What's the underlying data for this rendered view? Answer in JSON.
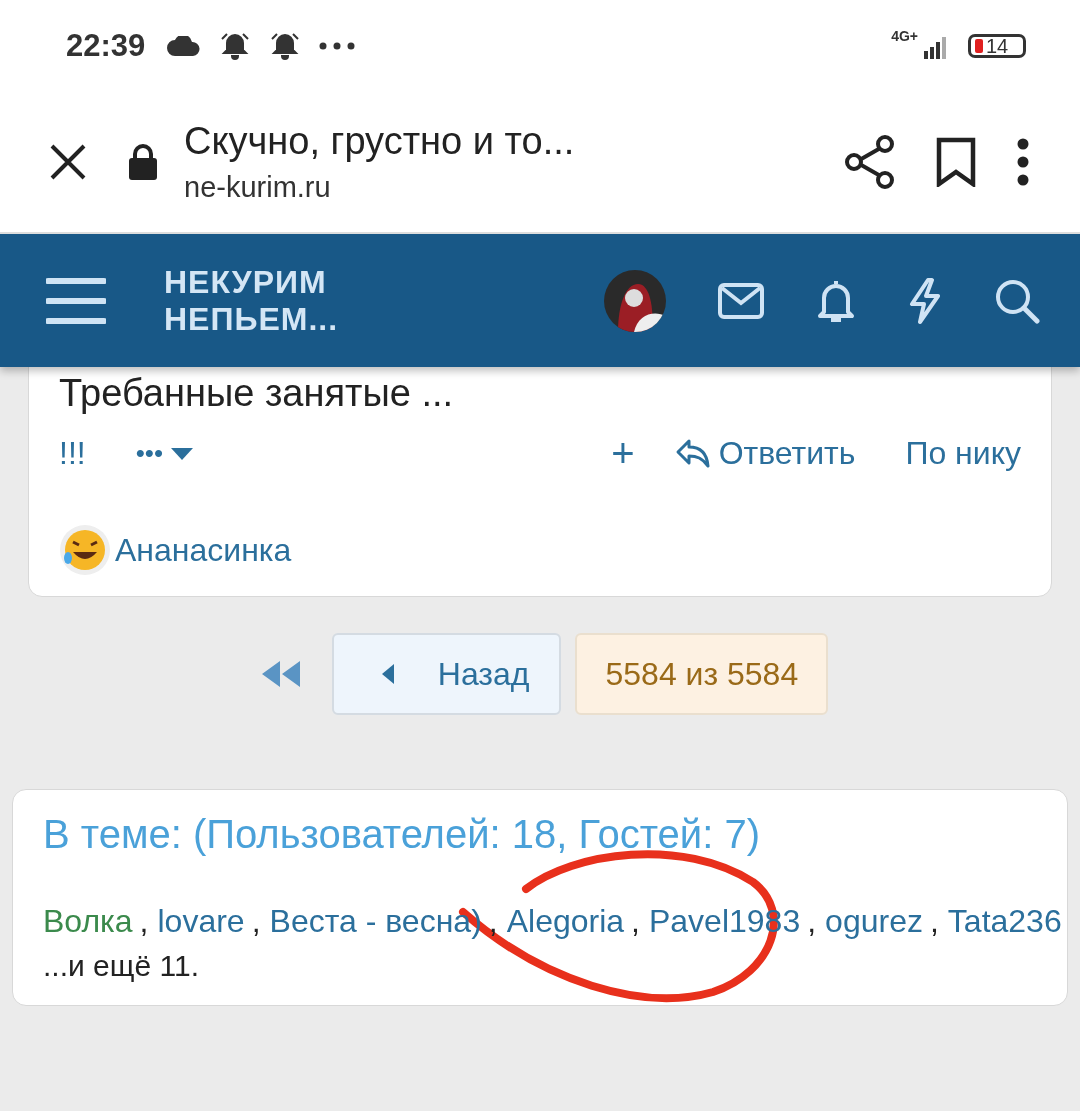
{
  "status_bar": {
    "time": "22:39",
    "network": "4G+",
    "battery": "14"
  },
  "browser": {
    "title": "Скучно, грустно и то...",
    "url": "ne-kurim.ru"
  },
  "site_header": {
    "logo_line_1": "НЕКУРИМ",
    "logo_line_2": "НЕПЬЕМ..."
  },
  "post": {
    "text_cut": "Требанные занятые ...",
    "actions_left": [
      "!!!",
      "•••"
    ],
    "add": "+",
    "reply": "Ответить",
    "by_nick": "По нику",
    "reaction_user": "Ананасинка"
  },
  "pagination": {
    "back": "Назад",
    "current": "5584 из 5584"
  },
  "online": {
    "title": "В теме: (Пользователей: 18, Гостей: 7)",
    "users": [
      {
        "name": "Волка",
        "color": "#3b8a4c"
      },
      {
        "name": "lovare",
        "color": "#2b6f9c"
      },
      {
        "name": "Веста - весна)",
        "color": "#2b6f9c"
      },
      {
        "name": "Alegoria",
        "color": "#2b6f9c"
      },
      {
        "name": "Pavel1983",
        "color": "#2b6f9c"
      },
      {
        "name": "ogurez",
        "color": "#2b6f9c"
      },
      {
        "name": "Tata236",
        "color": "#2b6f9c"
      }
    ],
    "separator": ",",
    "more": "...и ещё 11."
  }
}
